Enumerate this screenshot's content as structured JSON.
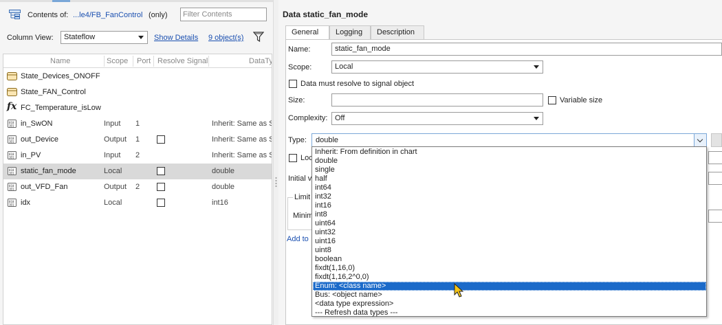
{
  "left": {
    "contents_label": "Contents of:",
    "contents_path": "...le4/FB_FanControl",
    "contents_scope": "(only)",
    "filter_placeholder": "Filter Contents",
    "column_view_label": "Column View:",
    "column_view_value": "Stateflow",
    "show_details": "Show Details",
    "object_count": "9 object(s)",
    "columns": [
      "Name",
      "Scope",
      "Port",
      "Resolve Signal",
      "DataTy"
    ],
    "rows": [
      {
        "icon": "state-icon",
        "name": "State_Devices_ONOFF",
        "scope": "",
        "port": "",
        "resolve": false,
        "datatype": ""
      },
      {
        "icon": "state-icon",
        "name": "State_FAN_Control",
        "scope": "",
        "port": "",
        "resolve": false,
        "datatype": ""
      },
      {
        "icon": "function-icon",
        "name": "FC_Temperature_isLow",
        "scope": "",
        "port": "",
        "resolve": false,
        "datatype": ""
      },
      {
        "icon": "data-icon",
        "name": "in_SwON",
        "scope": "Input",
        "port": "1",
        "resolve": false,
        "datatype": "Inherit: Same as S"
      },
      {
        "icon": "data-icon",
        "name": "out_Device",
        "scope": "Output",
        "port": "1",
        "resolve": true,
        "datatype": "Inherit: Same as S"
      },
      {
        "icon": "data-icon",
        "name": "in_PV",
        "scope": "Input",
        "port": "2",
        "resolve": false,
        "datatype": "Inherit: Same as S"
      },
      {
        "icon": "data-icon",
        "name": "static_fan_mode",
        "scope": "Local",
        "port": "",
        "resolve": true,
        "datatype": "double",
        "selected": true
      },
      {
        "icon": "data-icon",
        "name": "out_VFD_Fan",
        "scope": "Output",
        "port": "2",
        "resolve": true,
        "datatype": "double"
      },
      {
        "icon": "data-icon",
        "name": "idx",
        "scope": "Local",
        "port": "",
        "resolve": true,
        "datatype": "int16"
      }
    ]
  },
  "right": {
    "title": "Data static_fan_mode",
    "tabs": [
      "General",
      "Logging",
      "Description"
    ],
    "name_label": "Name:",
    "name_value": "static_fan_mode",
    "scope_label": "Scope:",
    "scope_value": "Local",
    "resolve_label": "Data must resolve to signal object",
    "size_label": "Size:",
    "variable_size_label": "Variable size",
    "complexity_label": "Complexity:",
    "complexity_value": "Off",
    "type_label": "Type:",
    "type_value": "double",
    "lock_label": "Loc",
    "initial_label": "Initial v",
    "limit_label": "Limit",
    "minimum_label": "Minim",
    "add_to_label": "Add to",
    "type_options": [
      "Inherit: From definition in chart",
      "double",
      "single",
      "half",
      "int64",
      "int32",
      "int16",
      "int8",
      "uint64",
      "uint32",
      "uint16",
      "uint8",
      "boolean",
      "fixdt(1,16,0)",
      "fixdt(1,16,2^0,0)",
      "Enum: <class name>",
      "Bus: <object name>",
      "<data type expression>",
      "--- Refresh data types ---"
    ],
    "highlighted_option": "Enum: <class name>"
  },
  "colors": {
    "link": "#1a4fb0",
    "highlight": "#1b6ac9",
    "selected_row": "#d9d9d9"
  }
}
